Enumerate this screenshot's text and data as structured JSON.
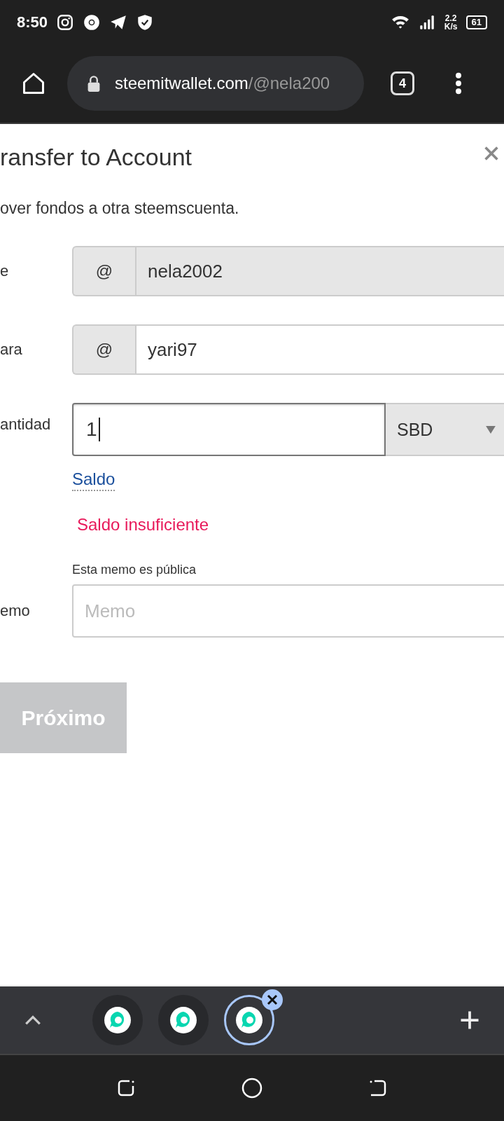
{
  "status_bar": {
    "time": "8:50",
    "speed_value": "2.2",
    "speed_unit": "K/s",
    "battery": "61"
  },
  "browser": {
    "url_host": "steemitwallet.com",
    "url_path": "/@nela200",
    "tab_count": "4"
  },
  "dialog": {
    "title": "ransfer to Account",
    "subtitle": "over fondos a otra steemscuenta.",
    "from": {
      "label": "e",
      "prefix": "@",
      "value": "nela2002",
      "disabled": true
    },
    "to": {
      "label": "ara",
      "prefix": "@",
      "value": "yari97",
      "disabled": false
    },
    "amount": {
      "label": "antidad",
      "value": "1",
      "focused": true,
      "currency": "SBD"
    },
    "balance_link": "Saldo",
    "error": "Saldo insuficiente",
    "memo": {
      "label": "emo",
      "hint": "Esta memo es pública",
      "placeholder": "Memo"
    },
    "next_button": {
      "label": "Próximo",
      "disabled": true
    }
  },
  "tab_strip": {
    "tabs": [
      {
        "selected": false
      },
      {
        "selected": false
      },
      {
        "selected": true
      }
    ]
  }
}
